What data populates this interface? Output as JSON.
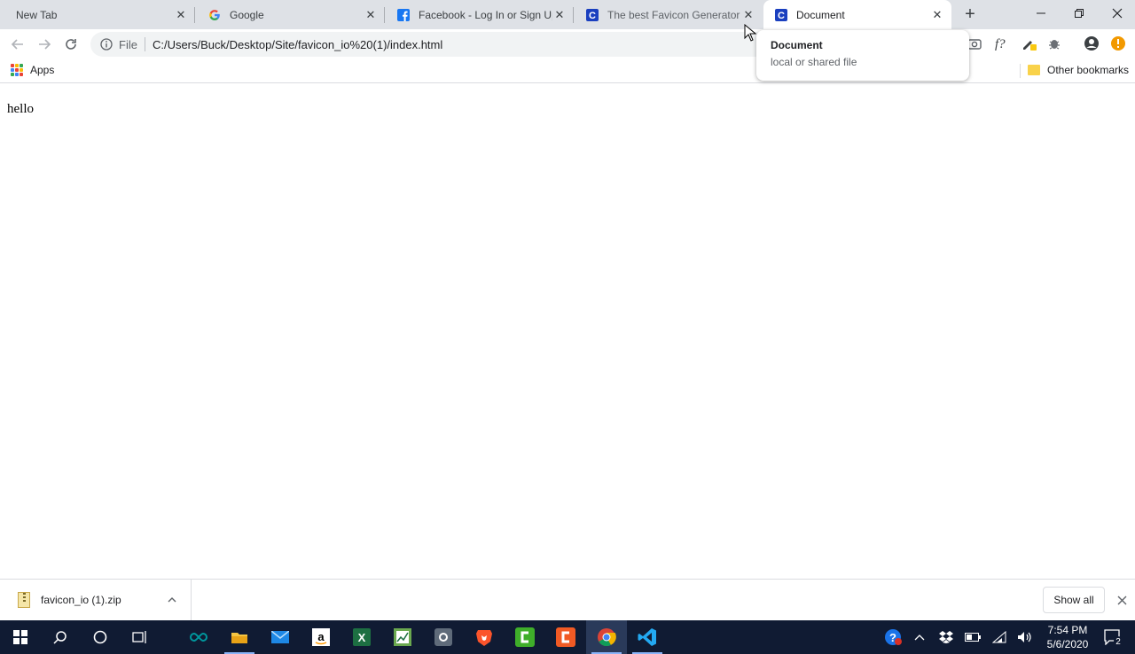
{
  "tabs": [
    {
      "title": "New Tab",
      "icon": "none"
    },
    {
      "title": "Google",
      "icon": "google-icon"
    },
    {
      "title": "Facebook - Log In or Sign Up",
      "icon": "facebook-icon"
    },
    {
      "title": "The best Favicon Generator (co",
      "icon": "favicon-c-icon"
    },
    {
      "title": "Document",
      "icon": "favicon-c-icon",
      "active": true
    }
  ],
  "toolbar": {
    "scheme": "File",
    "url": "C:/Users/Buck/Desktop/Site/favicon_io%20(1)/index.html"
  },
  "bookmarks": {
    "apps_label": "Apps",
    "other_label": "Other bookmarks"
  },
  "page": {
    "text": "hello"
  },
  "tooltip": {
    "title": "Document",
    "subtitle": "local or shared file"
  },
  "downloads": {
    "file_name": "favicon_io (1).zip",
    "show_all_label": "Show all"
  },
  "taskbar": {
    "time": "7:54 PM",
    "date": "5/6/2020",
    "notification_count": "2"
  },
  "colors": {
    "tab_strip": "#dee1e6",
    "taskbar": "#101b33",
    "accent_blue": "#1a73e8",
    "facebook_blue": "#1877f2",
    "favicon_c_blue": "#1a3fbf"
  }
}
